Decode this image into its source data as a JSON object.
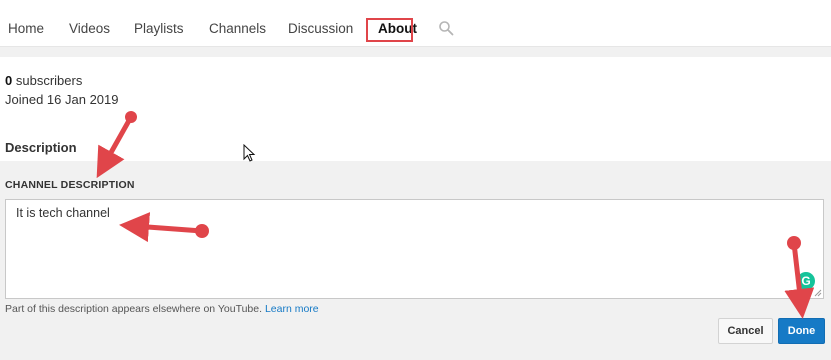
{
  "tabs": {
    "items": [
      {
        "label": "Home"
      },
      {
        "label": "Videos"
      },
      {
        "label": "Playlists"
      },
      {
        "label": "Channels"
      },
      {
        "label": "Discussion"
      },
      {
        "label": "About"
      }
    ],
    "active": "About",
    "search_icon": "search-icon"
  },
  "about": {
    "subscriber_count": "0",
    "subscribers_label": "subscribers",
    "joined": "Joined 16 Jan 2019",
    "description_heading": "Description"
  },
  "editor": {
    "label": "CHANNEL DESCRIPTION",
    "value": "It is tech channel",
    "hint": "Part of this description appears elsewhere on YouTube.",
    "learn_more": "Learn more",
    "grammarly_badge": "G",
    "cancel_label": "Cancel",
    "done_label": "Done"
  },
  "colors": {
    "annotation_red": "#e0454a",
    "accent_blue": "#167ac6",
    "grammarly_green": "#15c39a"
  }
}
